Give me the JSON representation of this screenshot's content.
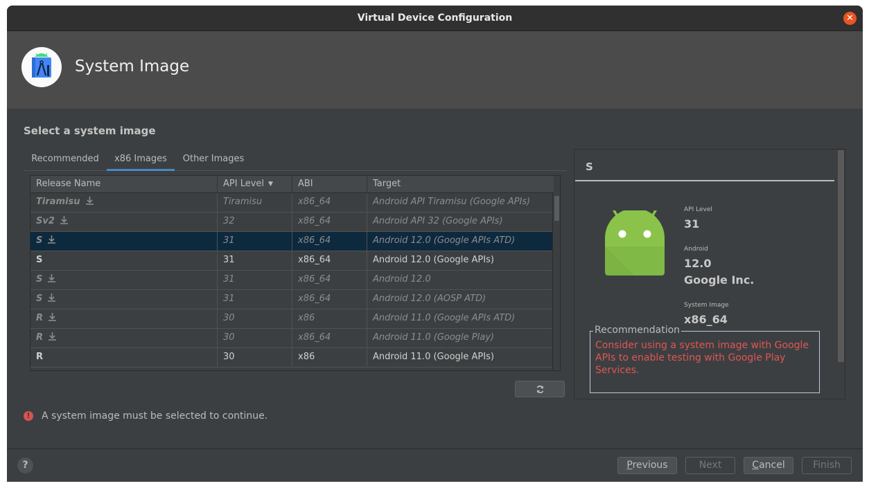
{
  "window": {
    "title": "Virtual Device Configuration",
    "close_icon": "close-icon"
  },
  "header": {
    "logo_icon": "android-studio-logo",
    "title": "System Image"
  },
  "section_title": "Select a system image",
  "tabs": [
    {
      "label": "Recommended",
      "active": false
    },
    {
      "label": "x86 Images",
      "active": true
    },
    {
      "label": "Other Images",
      "active": false
    }
  ],
  "table": {
    "columns": [
      {
        "label": "Release Name"
      },
      {
        "label": "API Level",
        "sort": "descending"
      },
      {
        "label": "ABI"
      },
      {
        "label": "Target"
      }
    ],
    "rows": [
      {
        "release": "Tiramisu",
        "download": true,
        "api": "Tiramisu",
        "abi": "x86_64",
        "target": "Android API Tiramisu (Google APIs)",
        "installed": false,
        "selected": false
      },
      {
        "release": "Sv2",
        "download": true,
        "api": "32",
        "abi": "x86_64",
        "target": "Android API 32 (Google APIs)",
        "installed": false,
        "selected": false
      },
      {
        "release": "S",
        "download": true,
        "api": "31",
        "abi": "x86_64",
        "target": "Android 12.0 (Google APIs ATD)",
        "installed": false,
        "selected": true
      },
      {
        "release": "S",
        "download": false,
        "api": "31",
        "abi": "x86_64",
        "target": "Android 12.0 (Google APIs)",
        "installed": true,
        "selected": false
      },
      {
        "release": "S",
        "download": true,
        "api": "31",
        "abi": "x86_64",
        "target": "Android 12.0",
        "installed": false,
        "selected": false
      },
      {
        "release": "S",
        "download": true,
        "api": "31",
        "abi": "x86_64",
        "target": "Android 12.0 (AOSP ATD)",
        "installed": false,
        "selected": false
      },
      {
        "release": "R",
        "download": true,
        "api": "30",
        "abi": "x86",
        "target": "Android 11.0 (Google APIs ATD)",
        "installed": false,
        "selected": false
      },
      {
        "release": "R",
        "download": true,
        "api": "30",
        "abi": "x86_64",
        "target": "Android 11.0 (Google Play)",
        "installed": false,
        "selected": false
      },
      {
        "release": "R",
        "download": false,
        "api": "30",
        "abi": "x86",
        "target": "Android 11.0 (Google APIs)",
        "installed": true,
        "selected": false
      }
    ]
  },
  "refresh_icon": "refresh-icon",
  "error": {
    "icon": "error-icon",
    "message": "A system image must be selected to continue."
  },
  "detail": {
    "title": "S",
    "api_level_label": "API Level",
    "api_level": "31",
    "android_label": "Android",
    "android_version": "12.0",
    "vendor": "Google Inc.",
    "system_image_label": "System Image",
    "system_image": "x86_64",
    "recommendation_label": "Recommendation",
    "recommendation_text": "Consider using a system image with Google APIs to enable testing with Google Play Services."
  },
  "footer": {
    "help_label": "?",
    "previous": {
      "mnemonic": "P",
      "rest": "revious",
      "enabled": true
    },
    "next": {
      "label": "Next",
      "enabled": false
    },
    "cancel": {
      "mnemonic": "C",
      "rest": "ancel",
      "enabled": true
    },
    "finish": {
      "label": "Finish",
      "enabled": false
    }
  },
  "colors": {
    "accent": "#4a88c7",
    "selection": "#0d293e",
    "error": "#e05555",
    "close": "#e95420",
    "android_green": "#8bc34a"
  }
}
